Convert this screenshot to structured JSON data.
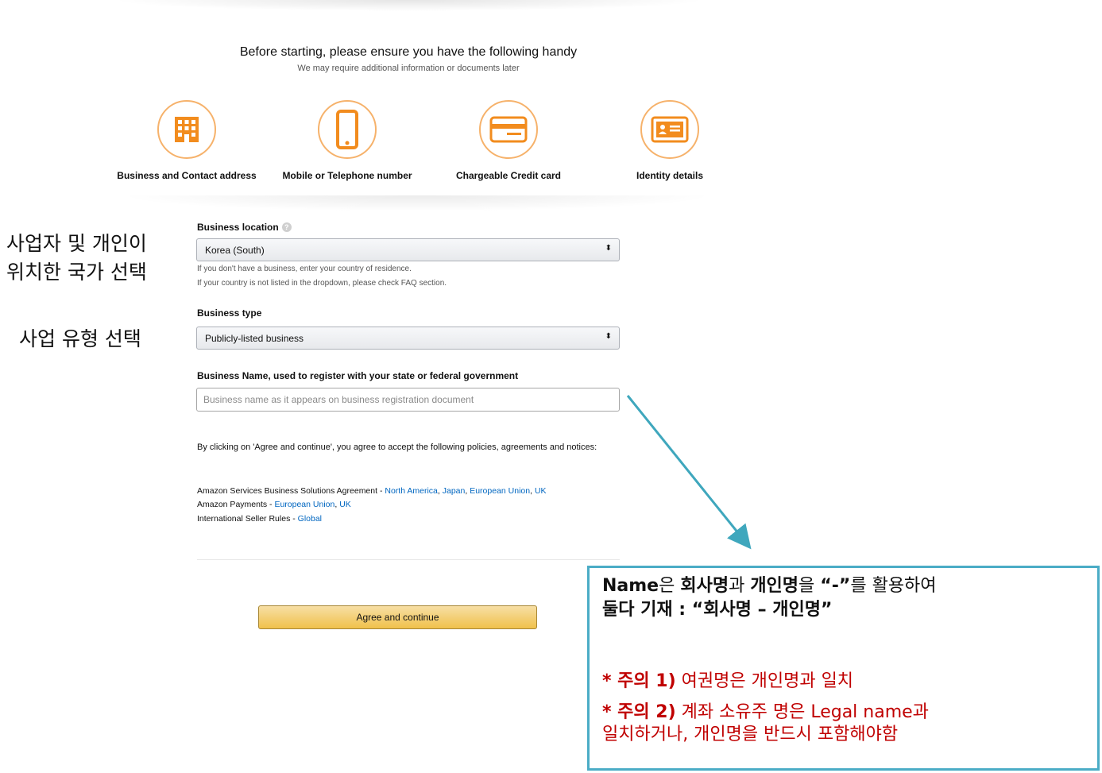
{
  "header": {
    "title": "Before starting, please ensure you have the following handy",
    "subtitle": "We may require additional information or documents later"
  },
  "requirements": [
    {
      "label": "Business and Contact address",
      "icon": "building-icon"
    },
    {
      "label": "Mobile or Telephone number",
      "icon": "mobile-phone-icon"
    },
    {
      "label": "Chargeable Credit card",
      "icon": "credit-card-icon"
    },
    {
      "label": "Identity details",
      "icon": "id-card-icon"
    }
  ],
  "form": {
    "location": {
      "label": "Business location",
      "value": "Korea (South)",
      "hint1": "If you don't have a business, enter your country of residence.",
      "hint2": "If your country is not listed in the dropdown, please check FAQ section."
    },
    "type": {
      "label": "Business type",
      "value": "Publicly-listed business"
    },
    "name": {
      "label": "Business Name, used to register with your state or federal government",
      "placeholder": "Business name as it appears on business registration document",
      "value": ""
    }
  },
  "policies": {
    "intro": "By clicking on 'Agree and continue', you agree to accept the following policies, agreements and notices:",
    "bsa": {
      "label": "Amazon Services Business Solutions Agreement - ",
      "links": [
        "North America",
        "Japan",
        "European Union",
        "UK"
      ]
    },
    "payments": {
      "label": "Amazon Payments - ",
      "links": [
        "European Union",
        "UK"
      ]
    },
    "seller_rules": {
      "label": "International Seller Rules - ",
      "links": [
        "Global"
      ]
    }
  },
  "agree_button": "Agree and continue",
  "annotations": {
    "location_line1": "사업자 및 개인이",
    "location_line2": "위치한 국가 선택",
    "type": "사업 유형 선택"
  },
  "callout": {
    "l1_a": "Name",
    "l1_b": "은 ",
    "l1_c": "회사명",
    "l1_d": "과 ",
    "l1_e": "개인명",
    "l1_f": "을 ",
    "l1_g": "“-”",
    "l1_h": "를 활용하여",
    "l2": "둘다 기재   :  “회사명 – 개인명”",
    "note1_a": "* 주의 1)",
    "note1_b": " 여권명은 개인명과 일치",
    "note2_a": "* 주의 2)",
    "note2_b": " 계좌 소유주 명은 Legal name과",
    "note2_c": "일치하거나, 개인명을 반드시 포함해야함"
  },
  "colors": {
    "icon_orange": "#f6b26b",
    "link_blue": "#0066c0",
    "button_gold": "#f0c14b",
    "callout_border": "#4bacc6",
    "warning_red": "#c00000"
  }
}
